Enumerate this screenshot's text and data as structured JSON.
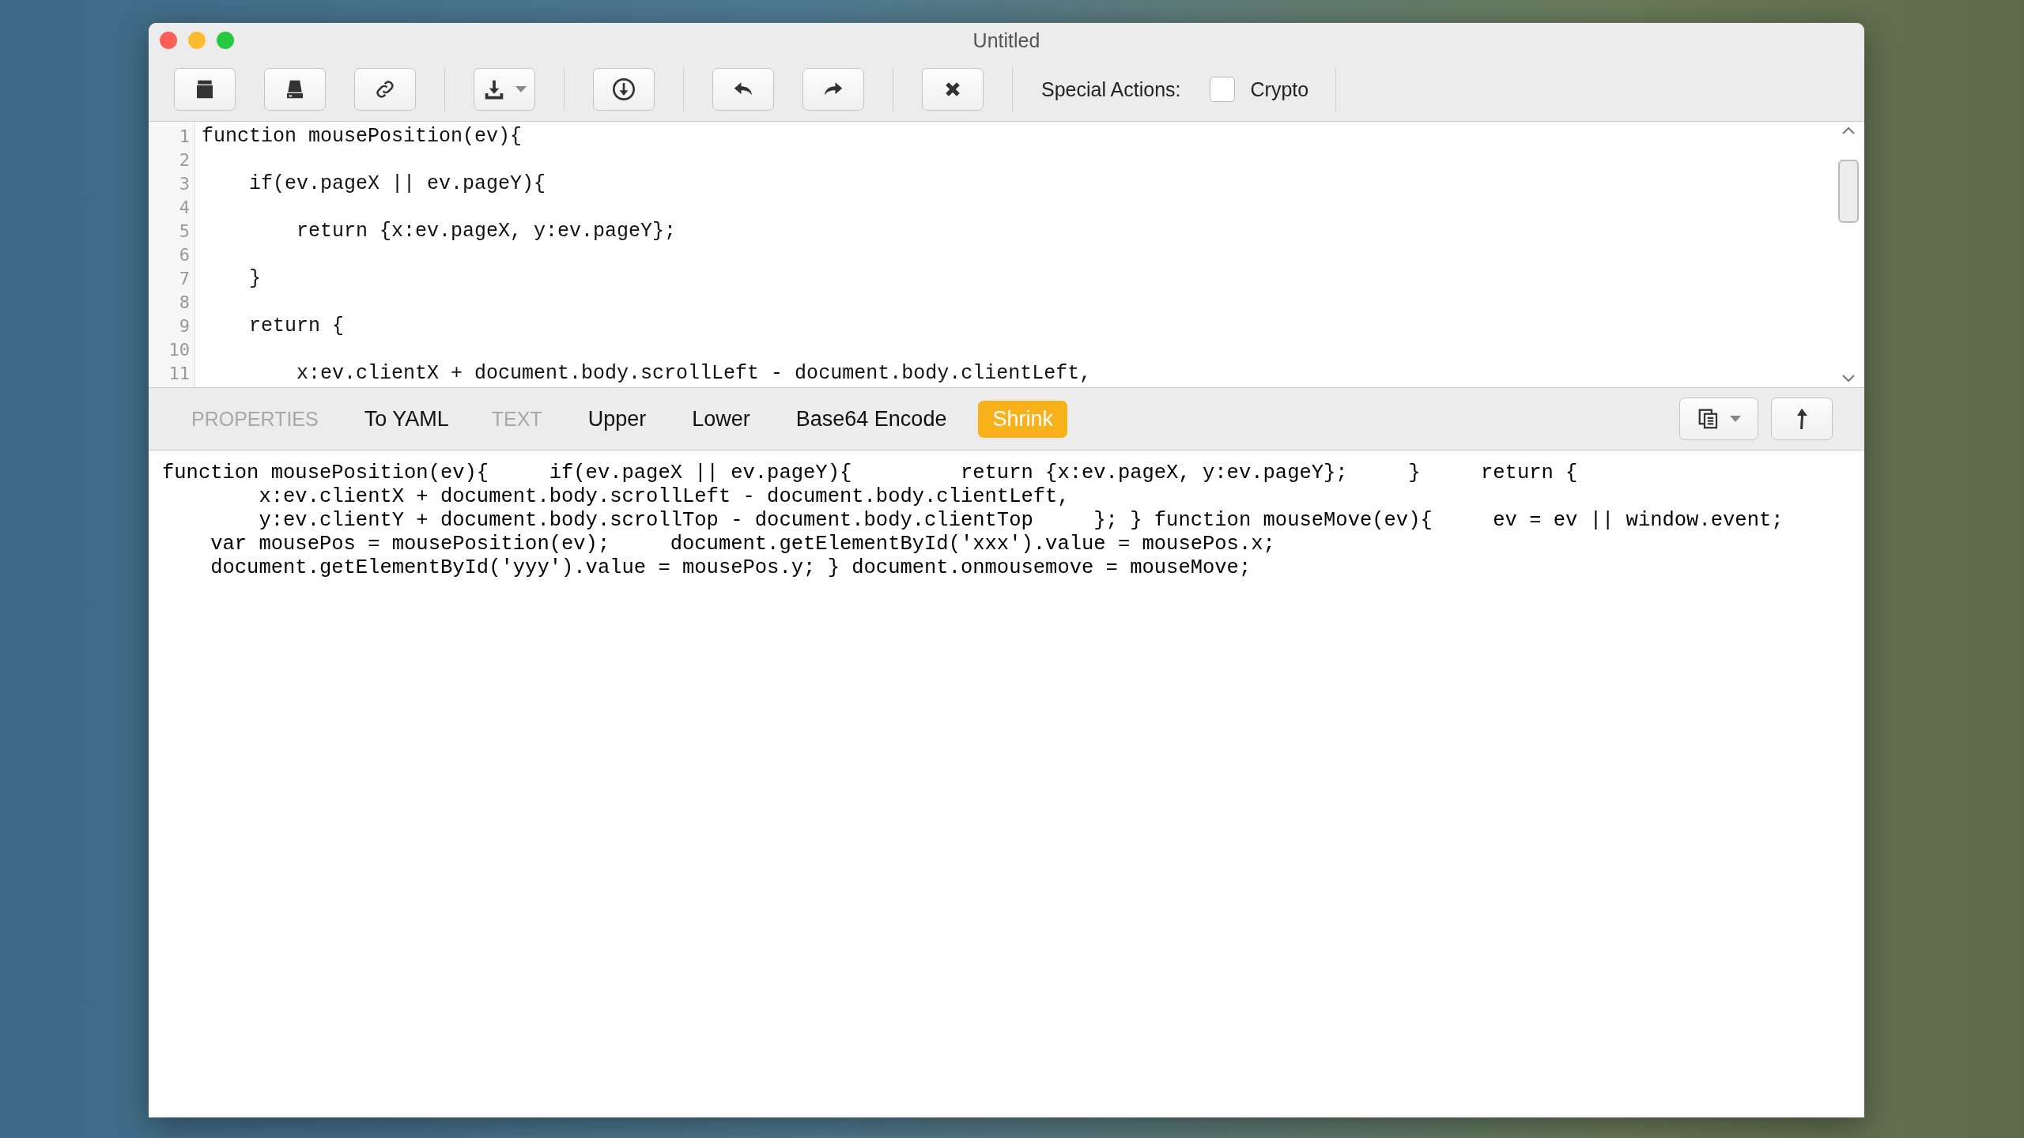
{
  "window": {
    "title": "Untitled"
  },
  "toolbar": {
    "buttons": [
      {
        "kind": "tray"
      },
      {
        "kind": "drive"
      },
      {
        "kind": "link"
      },
      {
        "kind": "download-menu"
      },
      {
        "kind": "download-circle"
      },
      {
        "kind": "undo"
      },
      {
        "kind": "redo"
      },
      {
        "kind": "clear"
      }
    ],
    "special_actions_label": "Special Actions:",
    "crypto": {
      "label": "Crypto",
      "checked": false
    }
  },
  "editor": {
    "lines": [
      {
        "number": "1",
        "code": "function mousePosition(ev){"
      },
      {
        "number": "2"
      },
      {
        "number": "3",
        "code": "    if(ev.pageX || ev.pageY){"
      },
      {
        "number": "4"
      },
      {
        "number": "5",
        "code": "        return {x:ev.pageX, y:ev.pageY};"
      },
      {
        "number": "6"
      },
      {
        "number": "7",
        "code": "    }"
      },
      {
        "number": "8"
      },
      {
        "number": "9",
        "code": "    return {"
      },
      {
        "number": "10"
      },
      {
        "number": "11",
        "code": "        x:ev.clientX + document.body.scrollLeft - document.body.clientLeft,"
      }
    ]
  },
  "actions": [
    {
      "kind": "heading",
      "label": "PROPERTIES"
    },
    {
      "kind": "action",
      "label": "To YAML",
      "selected": false
    },
    {
      "kind": "heading",
      "label": "TEXT"
    },
    {
      "kind": "action",
      "label": "Upper",
      "selected": false
    },
    {
      "kind": "action",
      "label": "Lower",
      "selected": false
    },
    {
      "kind": "action",
      "label": "Base64 Encode",
      "selected": false
    },
    {
      "kind": "action",
      "label": "Shrink",
      "selected": true
    }
  ],
  "output": {
    "lines": [
      "function mousePosition(ev){     if(ev.pageX || ev.pageY){         return {x:ev.pageX, y:ev.pageY};     }     return {",
      "        x:ev.clientX + document.body.scrollLeft - document.body.clientLeft,",
      "        y:ev.clientY + document.body.scrollTop - document.body.clientTop     }; } function mouseMove(ev){     ev = ev || window.event;",
      "    var mousePos = mousePosition(ev);     document.getElementById('xxx').value = mousePos.x;",
      "    document.getElementById('yyy').value = mousePos.y; } document.onmousemove = mouseMove;"
    ]
  }
}
